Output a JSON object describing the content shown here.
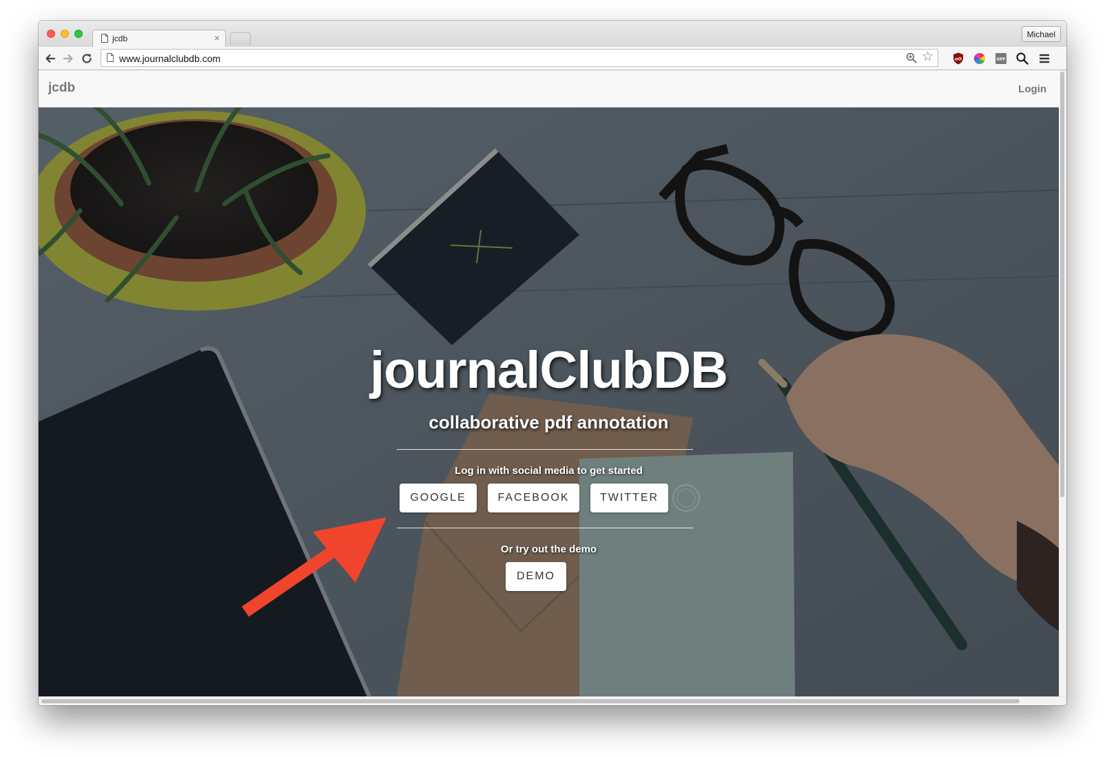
{
  "browser": {
    "tab_title": "jcdb",
    "tab_close": "×",
    "url": "www.journalclubdb.com",
    "profile_name": "Michael",
    "extensions": [
      "ublock-icon",
      "color-picker-icon",
      "off-toggle-icon",
      "search-icon",
      "menu-icon"
    ]
  },
  "site": {
    "brand": "jcdb",
    "nav_login": "Login"
  },
  "hero": {
    "title": "journalClubDB",
    "subtitle": "collaborative pdf annotation",
    "social_prompt": "Log in with social media to get started",
    "social_buttons": [
      "GOOGLE",
      "FACEBOOK",
      "TWITTER"
    ],
    "demo_prompt": "Or try out the demo",
    "demo_button": "DEMO"
  },
  "colors": {
    "arrow": "#f0452c",
    "hero_table": "#5c6770",
    "brand_text": "#777777"
  }
}
